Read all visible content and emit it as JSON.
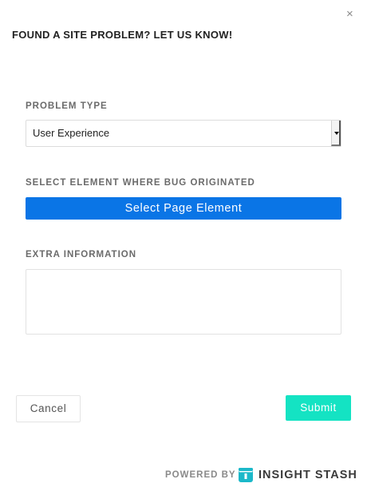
{
  "dialog": {
    "close_glyph": "×",
    "title": "FOUND A SITE PROBLEM? LET US KNOW!"
  },
  "problem_type": {
    "label": "PROBLEM TYPE",
    "selected": "User Experience"
  },
  "element_picker": {
    "label": "SELECT ELEMENT WHERE BUG ORIGINATED",
    "button_label": "Select Page Element"
  },
  "extra_info": {
    "label": "EXTRA INFORMATION",
    "value": ""
  },
  "actions": {
    "cancel_label": "Cancel",
    "submit_label": "Submit"
  },
  "footer": {
    "powered_by": "POWERED BY",
    "brand": "INSIGHT STASH"
  },
  "colors": {
    "primary_button": "#0a75e6",
    "submit_button": "#14e3c3",
    "brand_mark": "#1bb8c9"
  },
  "icons": {
    "close": "close-icon",
    "dropdown": "dropdown-arrow-icon",
    "logo": "insight-stash-logo-icon"
  }
}
